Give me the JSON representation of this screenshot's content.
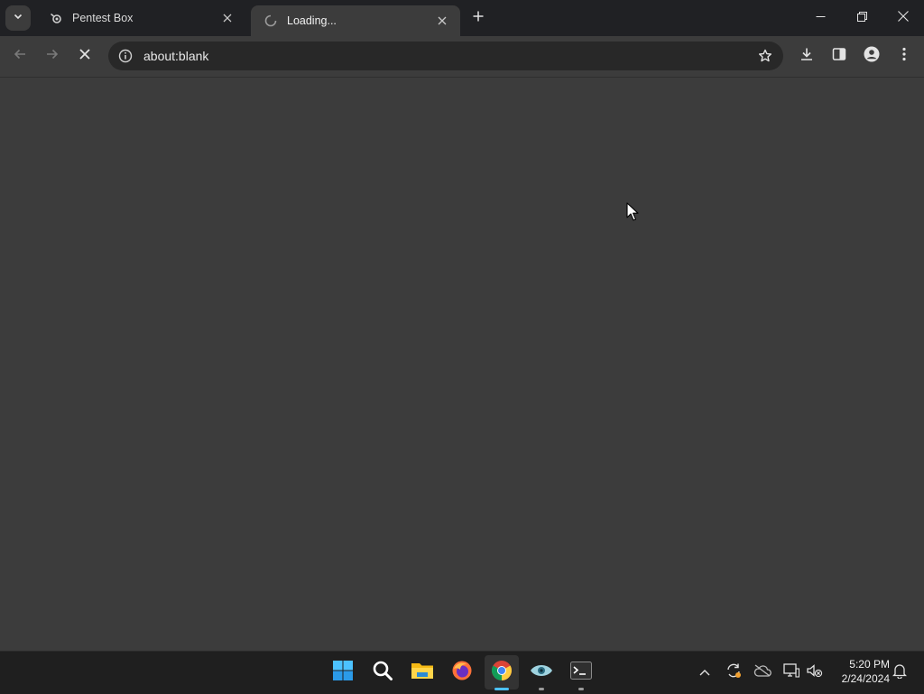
{
  "browser": {
    "tabs": [
      {
        "title": "Pentest Box",
        "favicon": "pentest-favicon",
        "active": false
      },
      {
        "title": "Loading...",
        "favicon": "loading-spinner",
        "active": true
      }
    ],
    "address": {
      "url": "about:blank"
    },
    "icons": {
      "tab_search": "chevron-down-icon",
      "new_tab": "plus-icon",
      "back": "back-arrow-icon",
      "forward": "forward-arrow-icon",
      "stop": "stop-icon",
      "site_info": "info-icon",
      "bookmark": "star-icon",
      "downloads": "download-icon",
      "side_panel": "side-panel-icon",
      "profile": "profile-icon",
      "menu": "kebab-menu-icon"
    }
  },
  "window_controls": [
    "minimize-icon",
    "restore-icon",
    "close-icon"
  ],
  "taskbar": {
    "apps": [
      {
        "name": "start-icon"
      },
      {
        "name": "search-icon"
      },
      {
        "name": "file-explorer-icon"
      },
      {
        "name": "firefox-icon"
      },
      {
        "name": "chrome-icon",
        "active": true
      },
      {
        "name": "eye-app-icon",
        "running": true
      },
      {
        "name": "terminal-icon",
        "running": true
      }
    ],
    "tray": [
      "chevron-up-icon",
      "sync-icon",
      "cloud-icon",
      "network-icon",
      "volume-muted-icon"
    ],
    "clock": {
      "time": "5:20 PM",
      "date": "2/24/2024"
    },
    "notification_icon": "bell-icon"
  },
  "colors": {
    "titlebar": "#202124",
    "toolbar": "#3c3c3c",
    "omnibox": "#282828",
    "taskbar": "#1f1f1f",
    "accent": "#4cc2ff"
  }
}
